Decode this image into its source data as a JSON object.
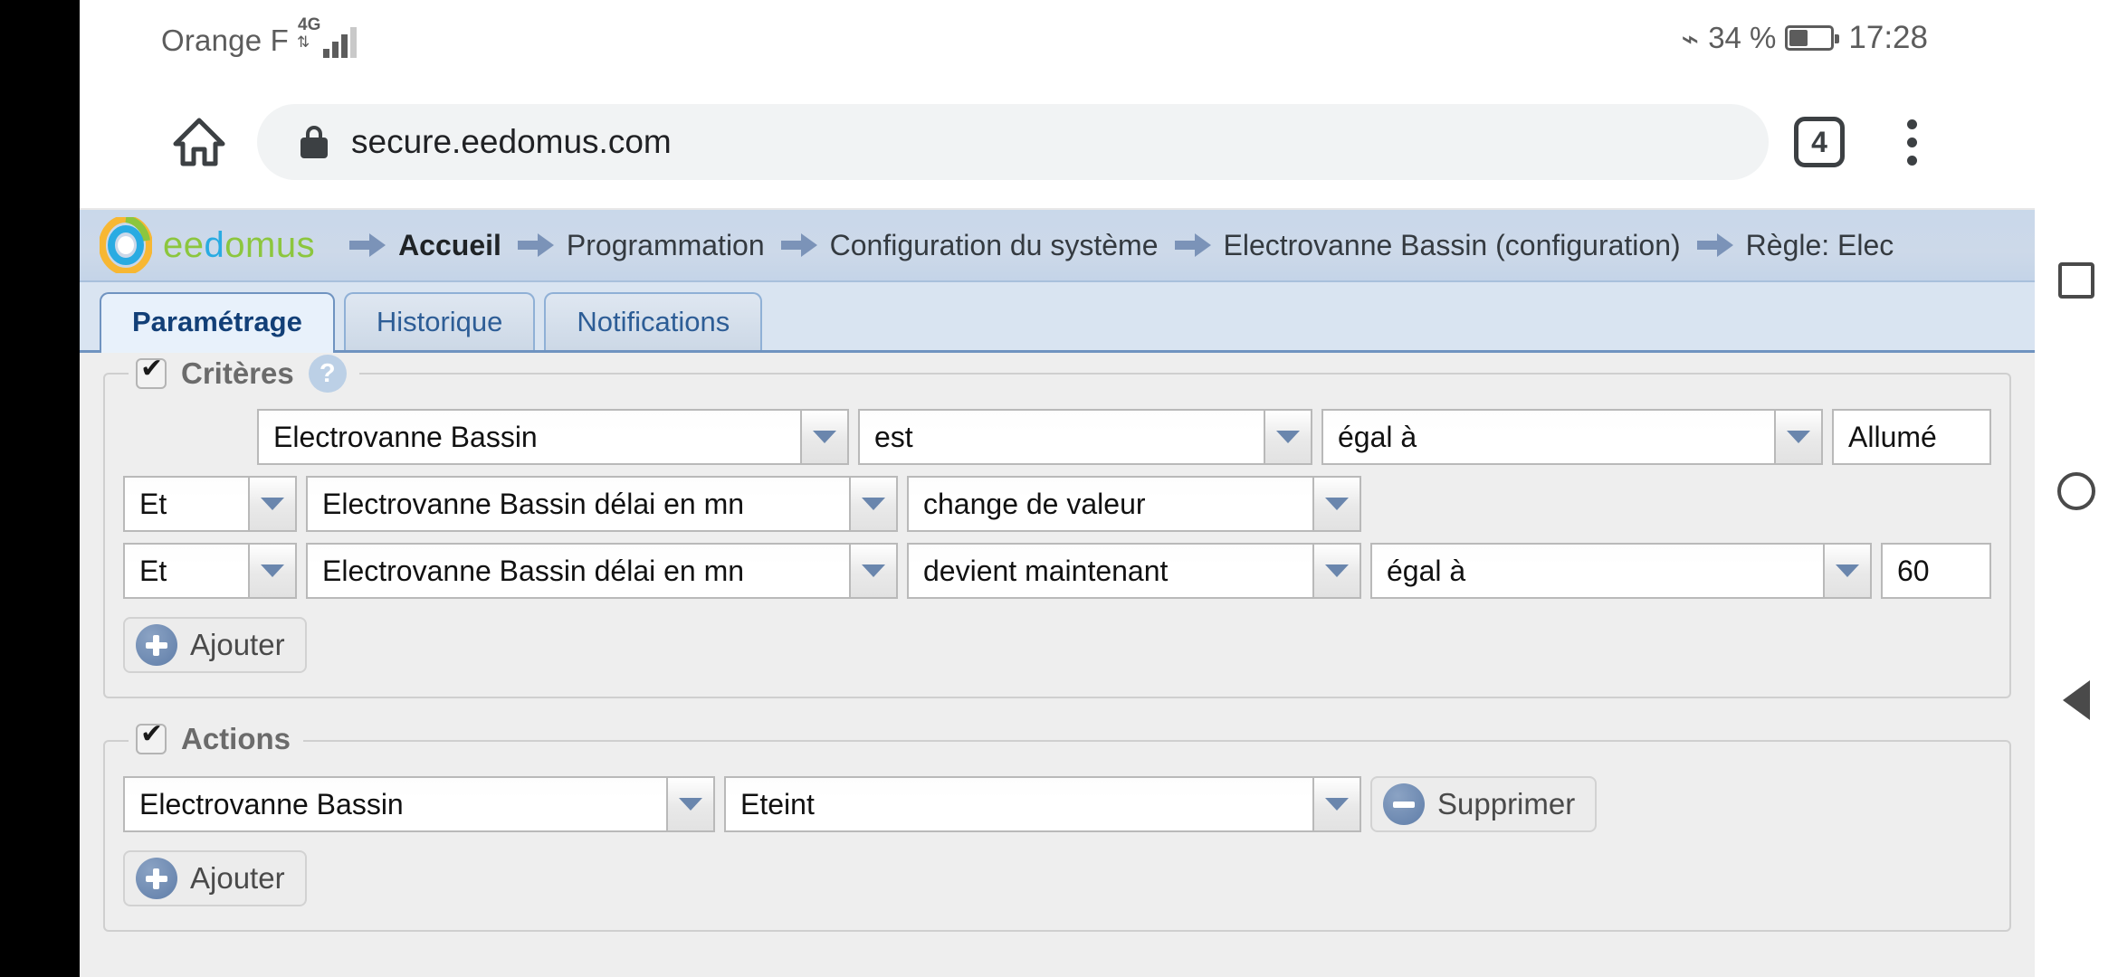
{
  "statusbar": {
    "carrier": "Orange F",
    "network_type": "4G",
    "bluetooth_icon": "bluetooth-icon",
    "battery_percent": "34 %",
    "battery_level": 40,
    "clock": "17:28"
  },
  "browser": {
    "home_icon": "home-icon",
    "lock_icon": "lock-icon",
    "url": "secure.eedomus.com",
    "tab_count": "4",
    "menu_icon": "overflow-menu-icon"
  },
  "site": {
    "logo_text_part1": "ee",
    "logo_text_part2": "d",
    "logo_text_part3": "omus",
    "logo_full": "eedomus",
    "breadcrumbs": [
      {
        "label": "Accueil",
        "active": true
      },
      {
        "label": "Programmation",
        "active": false
      },
      {
        "label": "Configuration du système",
        "active": false
      },
      {
        "label": "Electrovanne Bassin (configuration)",
        "active": false
      },
      {
        "label": "Règle: Elec",
        "active": false
      }
    ],
    "tabs": [
      {
        "label": "Paramétrage",
        "active": true
      },
      {
        "label": "Historique",
        "active": false
      },
      {
        "label": "Notifications",
        "active": false
      }
    ]
  },
  "criteria_section": {
    "legend": "Critères",
    "checkbox_checked": true,
    "help_icon": "help-icon",
    "help_glyph": "?",
    "rows": [
      {
        "conjunction": "",
        "device": "Electrovanne Bassin",
        "operator": "est",
        "comparator": "égal à",
        "value": "Allumé"
      },
      {
        "conjunction": "Et",
        "device": "Electrovanne Bassin délai en mn",
        "operator": "change de valeur",
        "comparator": "",
        "value": ""
      },
      {
        "conjunction": "Et",
        "device": "Electrovanne Bassin délai en mn",
        "operator": "devient maintenant",
        "comparator": "égal à",
        "value": "60"
      }
    ],
    "add_label": "Ajouter",
    "add_icon": "plus-circle-icon"
  },
  "actions_section": {
    "legend": "Actions",
    "checkbox_checked": true,
    "rows": [
      {
        "device": "Electrovanne Bassin",
        "state": "Eteint",
        "delete_label": "Supprimer",
        "delete_icon": "minus-circle-icon"
      }
    ],
    "add_label": "Ajouter",
    "add_icon": "plus-circle-icon"
  },
  "navkeys": {
    "recents": "square-recents-icon",
    "home": "circle-home-icon",
    "back": "triangle-back-icon"
  },
  "colors": {
    "accent_blue": "#6a86ad",
    "header_blue": "#cdd9e9",
    "tab_active": "#e8f1fb",
    "logo_green": "#8cc63e",
    "logo_blue": "#29abe2",
    "logo_orange": "#f7b733"
  }
}
